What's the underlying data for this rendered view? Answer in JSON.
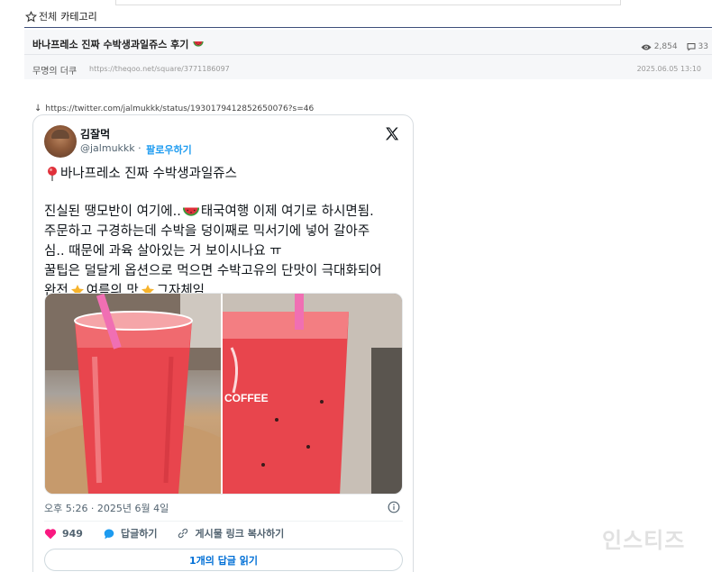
{
  "category": {
    "all_label": "전체",
    "current_label": "카테고리"
  },
  "post": {
    "title": "바나프레소 진짜 수박생과일쥬스 후기",
    "views": "2,854",
    "comments": "33",
    "author": "무명의 더쿠",
    "url": "https://theqoo.net/square/3771186097",
    "date": "2025.06.05 13:10"
  },
  "source_link": "https://twitter.com/jalmukkk/status/1930179412852650076?s=46",
  "tweet": {
    "name": "김잘먹",
    "handle": "@jalmukkk",
    "follow_label": "팔로우하기",
    "lines": {
      "l1": "바나프레소 진짜 수박생과일쥬스",
      "l2a": "진실된 땡모반이 여기에..",
      "l2b": " 태국여행 이제 여기로 하시면됨.",
      "l3": "주문하고 구경하는데 수박을 덩이째로 믹서기에 넣어 갈아주",
      "l4": "심.. 때문에 과육 살아있는 거 보이시나요 ㅠ",
      "l5": "꿀팁은 덜달게 옵션으로 먹으면 수박고유의 단맛이 극대화되어",
      "l6a": "완전 ",
      "l6b": "여름의 맛",
      "l6c": " 그자체임.."
    },
    "photo_text": "COFFEE",
    "timestamp": "오후 5:26 · 2025년 6월 4일",
    "likes": "949",
    "reply_label": "답글하기",
    "copy_label": "게시물 링크 복사하기",
    "read_replies_label": "1개의 답글 읽기"
  },
  "watermark": "인스티즈",
  "colors": {
    "accent": "#1d9bf0",
    "like": "#f91880",
    "juice": "#e8454d",
    "straw": "#f06fb3",
    "category_line": "#3d4e7a"
  }
}
